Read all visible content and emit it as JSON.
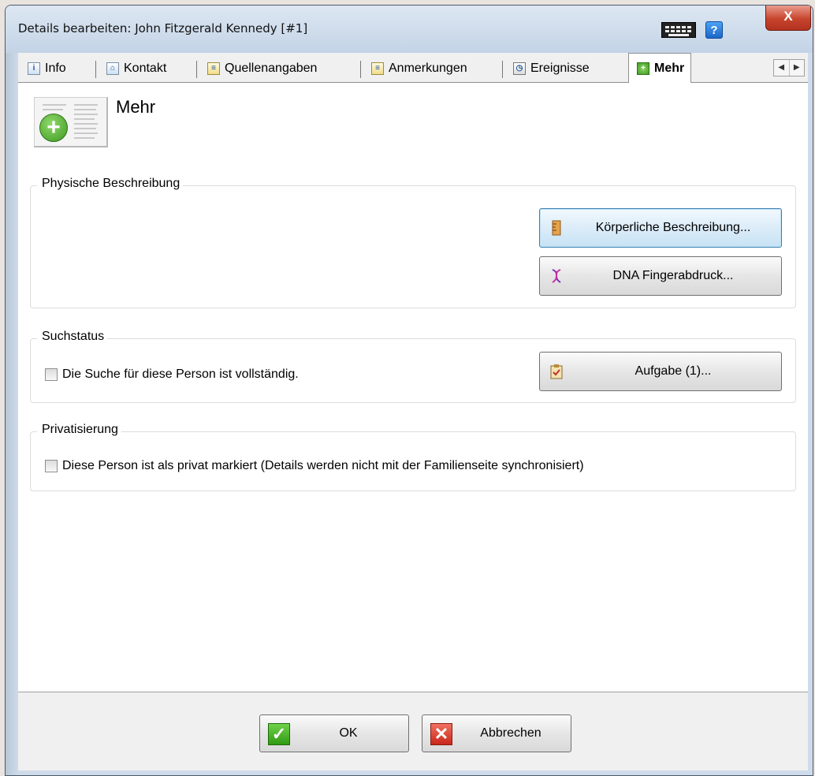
{
  "window": {
    "title": "Details bearbeiten: John Fitzgerald Kennedy [#1]",
    "close_label": "X",
    "help_label": "?"
  },
  "tabs": [
    {
      "label": "Info",
      "icon": "info-icon"
    },
    {
      "label": "Kontakt",
      "icon": "house-icon"
    },
    {
      "label": "Quellenangaben",
      "icon": "sources-icon"
    },
    {
      "label": "Anmerkungen",
      "icon": "notes-icon"
    },
    {
      "label": "Ereignisse",
      "icon": "clock-icon"
    },
    {
      "label": "Mehr",
      "icon": "plus-icon",
      "active": true
    }
  ],
  "page": {
    "title": "Mehr"
  },
  "groups": {
    "physical": {
      "legend": "Physische Beschreibung",
      "body_button": "Körperliche Beschreibung...",
      "dna_button": "DNA Fingerabdruck..."
    },
    "research": {
      "legend": "Suchstatus",
      "checkbox_label": "Die Suche für diese Person ist vollständig.",
      "task_button": "Aufgabe (1)..."
    },
    "privacy": {
      "legend": "Privatisierung",
      "checkbox_label": "Diese Person ist als privat markiert (Details werden nicht mit der Familienseite synchronisiert)"
    }
  },
  "footer": {
    "ok_label": "OK",
    "cancel_label": "Abbrechen"
  },
  "colors": {
    "ok_green": "#3aa81e",
    "cancel_red": "#d8321f",
    "accent_blue": "#3c7fb1"
  }
}
